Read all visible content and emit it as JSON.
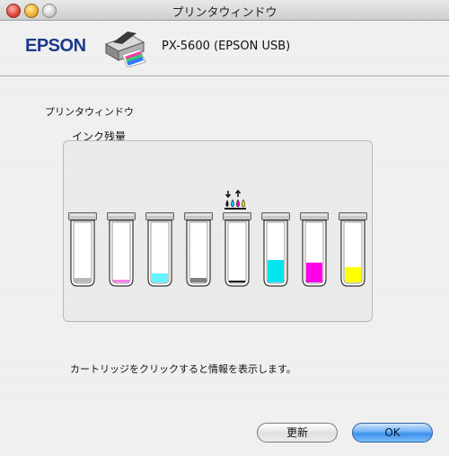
{
  "window": {
    "title": "プリンタウィンドウ"
  },
  "header": {
    "brand": "EPSON",
    "model": "PX-5600 (EPSON USB)"
  },
  "section": {
    "title": "プリンタウィンドウ",
    "group_label": "インク残量"
  },
  "cartridges": [
    {
      "id": "photo-black",
      "color": "#b8b8b8",
      "level": 0.08
    },
    {
      "id": "light-magenta",
      "color": "#ff7fe8",
      "level": 0.05
    },
    {
      "id": "light-cyan",
      "color": "#66f2ff",
      "level": 0.15
    },
    {
      "id": "light-black",
      "color": "#808080",
      "level": 0.08
    },
    {
      "id": "matte-black",
      "color": "#111111",
      "level": 0.02
    },
    {
      "id": "cyan",
      "color": "#00e5ee",
      "level": 0.38
    },
    {
      "id": "magenta",
      "color": "#ff00e8",
      "level": 0.33
    },
    {
      "id": "yellow",
      "color": "#ffff00",
      "level": 0.25
    }
  ],
  "hint": "カートリッジをクリックすると情報を表示します。",
  "buttons": {
    "refresh": "更新",
    "ok": "OK"
  }
}
